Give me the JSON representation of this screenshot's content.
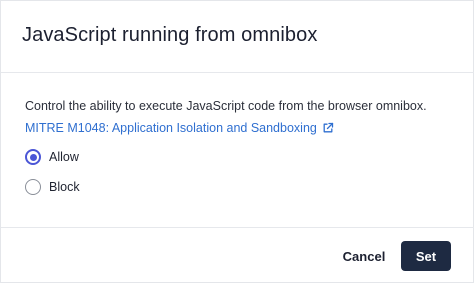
{
  "dialog": {
    "title": "JavaScript running from omnibox",
    "description": "Control the ability to execute JavaScript code from the browser omnibox.",
    "reference_link": {
      "label": "MITRE M1048: Application Isolation and Sandboxing",
      "icon": "external-link-icon"
    },
    "options": [
      {
        "label": "Allow",
        "selected": true
      },
      {
        "label": "Block",
        "selected": false
      }
    ],
    "cancel_label": "Cancel",
    "set_label": "Set"
  },
  "colors": {
    "accent": "#4b56d6",
    "link": "#2f6fd0",
    "primary_button": "#1e2a42"
  }
}
